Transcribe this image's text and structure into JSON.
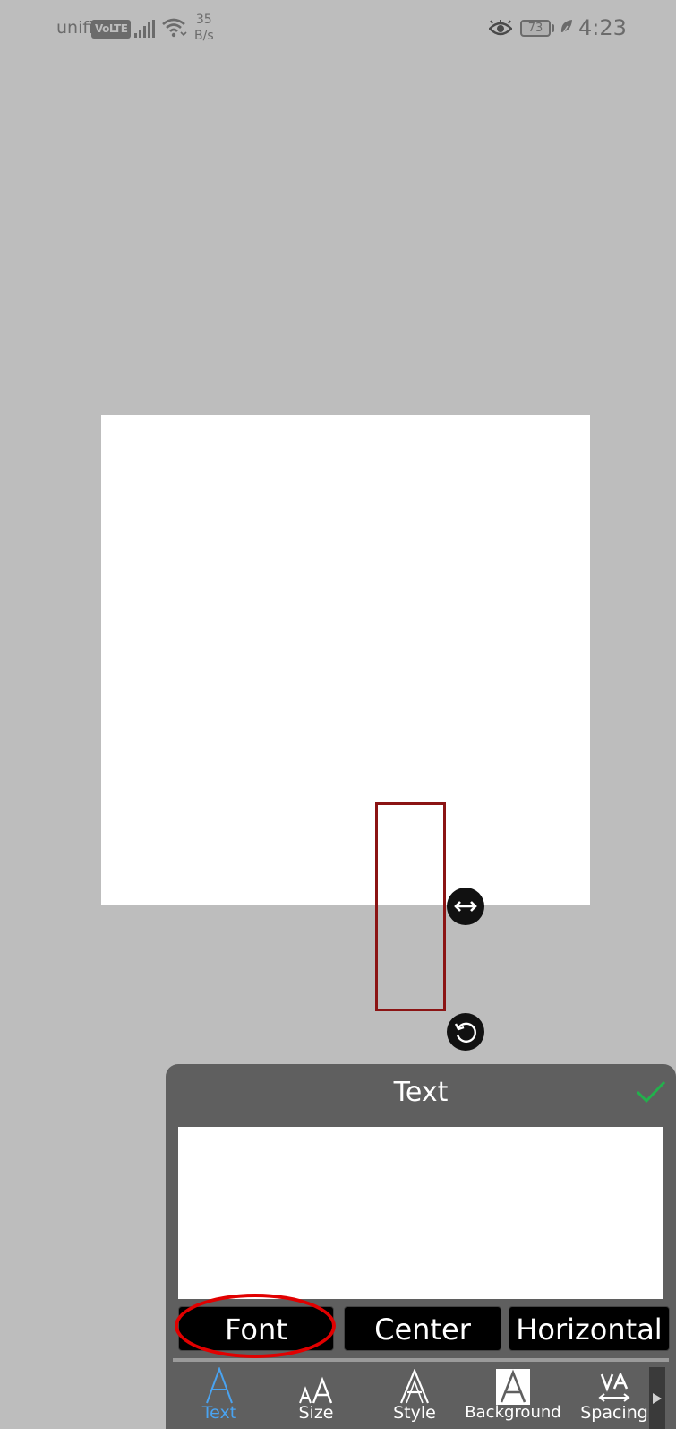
{
  "status_bar": {
    "carrier": "unifi",
    "volte": "VoLTE",
    "net_speed_value": "35",
    "net_speed_unit": "B/s",
    "battery": "73",
    "time": "4:23"
  },
  "panel": {
    "title": "Text",
    "text_value": "",
    "buttons": {
      "font": "Font",
      "center": "Center",
      "horizontal": "Horizontal"
    },
    "tabs": [
      {
        "label": "Text",
        "icon": "text-a-icon"
      },
      {
        "label": "Size",
        "icon": "text-size-icon"
      },
      {
        "label": "Style",
        "icon": "text-style-icon"
      },
      {
        "label": "Background",
        "icon": "text-background-icon"
      },
      {
        "label": "Spacing",
        "icon": "letter-spacing-icon"
      }
    ]
  },
  "colors": {
    "background": "#bdbdbd",
    "panel": "#5f5f5f",
    "active_tab": "#4aa3f0",
    "confirm": "#22b14c",
    "highlight_circle": "#e10000",
    "text_box_border": "#8b1414"
  }
}
